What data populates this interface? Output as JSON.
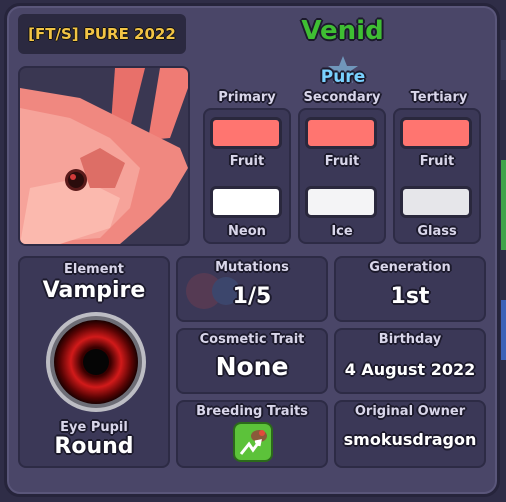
{
  "tag": "[FT/S] PURE 2022",
  "name": "Venid",
  "pure_label": "Pure",
  "colors": {
    "name_color": "#3fbe33",
    "pure_color": "#7ad2ff",
    "tag_color": "#f2c445"
  },
  "traits": [
    {
      "header": "Primary",
      "top": {
        "label": "Fruit",
        "color": "#ff7570"
      },
      "bottom": {
        "label": "Neon",
        "color": "#ffffff"
      }
    },
    {
      "header": "Secondary",
      "top": {
        "label": "Fruit",
        "color": "#ff7570"
      },
      "bottom": {
        "label": "Ice",
        "color": "#f4f4f6"
      }
    },
    {
      "header": "Tertiary",
      "top": {
        "label": "Fruit",
        "color": "#ff7570"
      },
      "bottom": {
        "label": "Glass",
        "color": "#e6e6ea"
      }
    }
  ],
  "element": {
    "label": "Element",
    "value": "Vampire"
  },
  "eye_pupil": {
    "label": "Eye Pupil",
    "value": "Round"
  },
  "mutations": {
    "label": "Mutations",
    "value": "1/5"
  },
  "generation": {
    "label": "Generation",
    "value": "1st"
  },
  "cosmetic_trait": {
    "label": "Cosmetic Trait",
    "value": "None"
  },
  "birthday": {
    "label": "Birthday",
    "value": "4 August 2022"
  },
  "breeding_traits": {
    "label": "Breeding Traits",
    "icon": "frog-growth-icon"
  },
  "original_owner": {
    "label": "Original Owner",
    "value": "smokusdragon"
  }
}
